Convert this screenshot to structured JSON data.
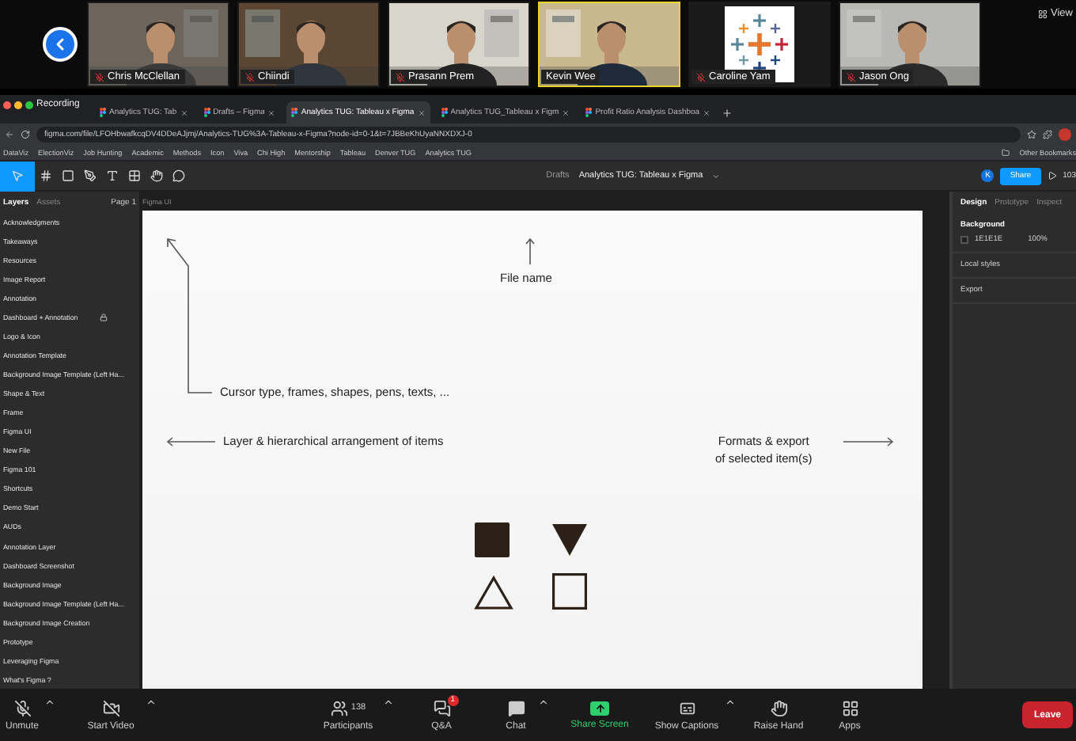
{
  "meeting": {
    "view_label": "View",
    "participants": [
      {
        "name": "Chris McClellan",
        "muted": true,
        "speaking": false,
        "kind": "video"
      },
      {
        "name": "Chiindi",
        "muted": true,
        "speaking": false,
        "kind": "video"
      },
      {
        "name": "Prasann Prem",
        "muted": true,
        "speaking": false,
        "kind": "video"
      },
      {
        "name": "Kevin Wee",
        "muted": false,
        "speaking": true,
        "kind": "video"
      },
      {
        "name": "Caroline Yam",
        "muted": true,
        "speaking": false,
        "kind": "logo"
      },
      {
        "name": "Jason Ong",
        "muted": true,
        "speaking": false,
        "kind": "video"
      }
    ]
  },
  "recording": "Recording",
  "browser": {
    "tabs": [
      {
        "title": "Analytics TUG: Tab",
        "selected": false
      },
      {
        "title": "Drafts – Figma",
        "selected": false
      },
      {
        "title": "Analytics TUG: Tableau x Figma",
        "selected": true
      },
      {
        "title": "Analytics TUG_Tableau x Figm",
        "selected": false
      },
      {
        "title": "Profit Ratio Analysis Dashboa",
        "selected": false
      }
    ],
    "url": "figma.com/file/LFOHbwafkcqDV4DDeAJjmj/Analytics-TUG%3A-Tableau-x-Figma?node-id=0-1&t=7JBBeKhUyaNNXDXJ-0",
    "bookmarks": [
      "DataViz",
      "ElectionViz",
      "Job Hunting",
      "Academic",
      "Methods",
      "Icon",
      "Viva",
      "Chi High",
      "Mentorship",
      "Tableau",
      "Denver TUG",
      "Analytics TUG"
    ],
    "other_bookmarks": "Other Bookmarks"
  },
  "figma": {
    "tools": [
      {
        "kind": "move",
        "selected": true
      },
      {
        "kind": "frame",
        "selected": false
      },
      {
        "kind": "shape",
        "selected": false
      },
      {
        "kind": "pen",
        "selected": false
      },
      {
        "kind": "text",
        "selected": false
      },
      {
        "kind": "component",
        "selected": false
      },
      {
        "kind": "hand",
        "selected": false
      },
      {
        "kind": "comment",
        "selected": false
      }
    ],
    "breadcrumb_parent": "Drafts",
    "file_name": "Analytics TUG: Tableau x Figma",
    "avatar": "K",
    "share": "Share",
    "zoom_level": "103",
    "left_tabs": [
      {
        "label": "Layers",
        "selected": true
      },
      {
        "label": "Assets",
        "selected": false
      }
    ],
    "page": "Page 1",
    "layers": [
      {
        "name": "Acknowledgments",
        "locked": false
      },
      {
        "name": "Takeaways",
        "locked": false
      },
      {
        "name": "Resources",
        "locked": false
      },
      {
        "name": "Image Report",
        "locked": false
      },
      {
        "name": "Annotation",
        "locked": false
      },
      {
        "name": "Dashboard + Annotation",
        "locked": true
      },
      {
        "name": "Logo & Icon",
        "locked": false
      },
      {
        "name": "Annotation Template",
        "locked": false
      },
      {
        "name": "Background Image Template (Left Ha...",
        "locked": false
      },
      {
        "name": "Shape & Text",
        "locked": false
      },
      {
        "name": "Frame",
        "locked": false
      },
      {
        "name": "Figma UI",
        "locked": false
      },
      {
        "name": "New File",
        "locked": false
      },
      {
        "name": "Figma 101",
        "locked": false
      },
      {
        "name": "Shortcuts",
        "locked": false
      },
      {
        "name": "Demo Start",
        "locked": false
      },
      {
        "name": "AUDs",
        "locked": false
      },
      {
        "name": "Annotation Layer",
        "locked": false
      },
      {
        "name": "Dashboard Screenshot",
        "locked": false
      },
      {
        "name": "Background Image",
        "locked": false
      },
      {
        "name": "Background Image Template (Left Ha...",
        "locked": false
      },
      {
        "name": "Background Image Creation",
        "locked": false
      },
      {
        "name": "Prototype",
        "locked": false
      },
      {
        "name": "Leveraging Figma",
        "locked": false
      },
      {
        "name": "What's Figma ?",
        "locked": false
      }
    ],
    "frame_label": "Figma UI",
    "notes": {
      "cursor": "Cursor type, frames, shapes, pens, texts, ...",
      "file": "File name",
      "layers": "Layer & hierarchical arrangement of items",
      "formats": [
        "Formats & export",
        "of selected item(s)"
      ]
    },
    "right_tabs": [
      {
        "label": "Design",
        "selected": true
      },
      {
        "label": "Prototype",
        "selected": false
      },
      {
        "label": "Inspect",
        "selected": false
      }
    ],
    "background_title": "Background",
    "background_hex": "1E1E1E",
    "background_opacity": "100%",
    "local_styles": "Local styles",
    "export": "Export"
  },
  "toolbar": {
    "items": [
      {
        "kind": "mic",
        "label": "Unmute",
        "caret": true
      },
      {
        "kind": "video",
        "label": "Start Video",
        "caret": true
      },
      {
        "kind": "participants",
        "label": "Participants",
        "count": "138",
        "caret": true
      },
      {
        "kind": "qa",
        "label": "Q&A",
        "badge": "1",
        "caret": false
      },
      {
        "kind": "chat",
        "label": "Chat",
        "caret": true
      },
      {
        "kind": "share",
        "label": "Share Screen",
        "caret": false
      },
      {
        "kind": "captions",
        "label": "Show Captions",
        "caret": true
      },
      {
        "kind": "hand",
        "label": "Raise Hand",
        "caret": false
      },
      {
        "kind": "apps",
        "label": "Apps",
        "caret": false
      }
    ],
    "leave": "Leave"
  }
}
